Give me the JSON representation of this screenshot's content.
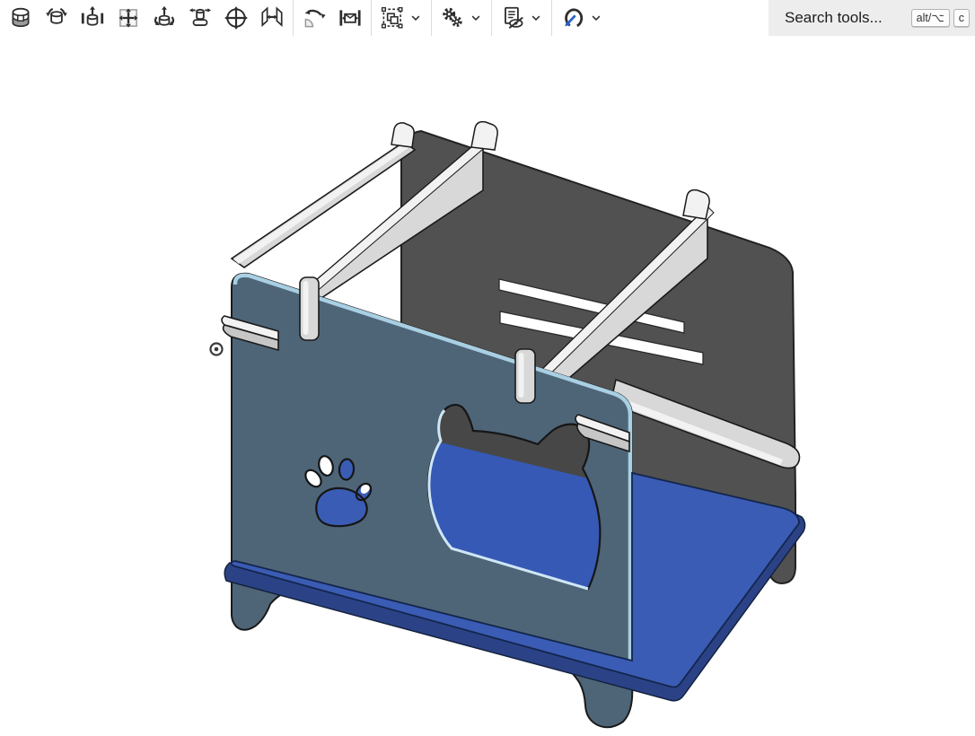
{
  "toolbar": {
    "groups": [
      {
        "items": [
          {
            "icon": "section-view"
          },
          {
            "icon": "orbit-cylinder"
          },
          {
            "icon": "pan-cylinder"
          },
          {
            "icon": "pan-view"
          },
          {
            "icon": "orbit-up"
          },
          {
            "icon": "turntable-rotate"
          },
          {
            "icon": "sphere-orbit"
          },
          {
            "icon": "mirror-view"
          }
        ]
      },
      {
        "items": [
          {
            "icon": "rotate-view"
          },
          {
            "icon": "zoom-to-fit"
          }
        ]
      },
      {
        "items": [
          {
            "icon": "select-tools",
            "dropdown": true
          }
        ]
      },
      {
        "items": [
          {
            "icon": "settings-gears",
            "dropdown": true
          }
        ]
      },
      {
        "items": [
          {
            "icon": "hide-items",
            "dropdown": true
          }
        ]
      },
      {
        "items": [
          {
            "icon": "orbit-tool",
            "dropdown": true
          }
        ]
      }
    ],
    "search": {
      "placeholder": "Search tools...",
      "shortcut_keys": [
        "alt/⌥",
        "c"
      ]
    }
  },
  "viewport": {
    "background": "#ffffff",
    "origin_marker": true,
    "model": {
      "name": "cat house laser-cut assembly",
      "cutouts": [
        "cat-head opening",
        "paw print"
      ],
      "colors": {
        "slate": "#4e6578",
        "slate_edge": "#a9cfe3",
        "back": "#515151",
        "back_leg": "#4d4d4d",
        "floor": "#3a5cb4",
        "hole_floor": "#3659b6",
        "hole_back": "#474747",
        "floor_edge": "#2b4386",
        "rail_light": "#f2f2f2",
        "rail_mid": "#d8d8d8",
        "rail_gray": "#c6c6c6",
        "rim": "#cfe6f4",
        "white": "#ffffff",
        "outline": "#1a1a1a"
      },
      "parts": [
        {
          "name": "back panel",
          "color_key": "back"
        },
        {
          "name": "front panel with cat opening, paw print cutout and feet",
          "color_key": "slate"
        },
        {
          "name": "floor panel",
          "color_key": "floor"
        },
        {
          "name": "left flat rail",
          "color_key": "rail_light"
        },
        {
          "name": "left plank rail",
          "color_key": "rail_mid"
        },
        {
          "name": "right plank rail",
          "color_key": "rail_mid"
        },
        {
          "name": "right flat rail",
          "color_key": "rail_mid"
        },
        {
          "name": "assembly tabs",
          "color_key": "rail_light"
        }
      ]
    }
  }
}
